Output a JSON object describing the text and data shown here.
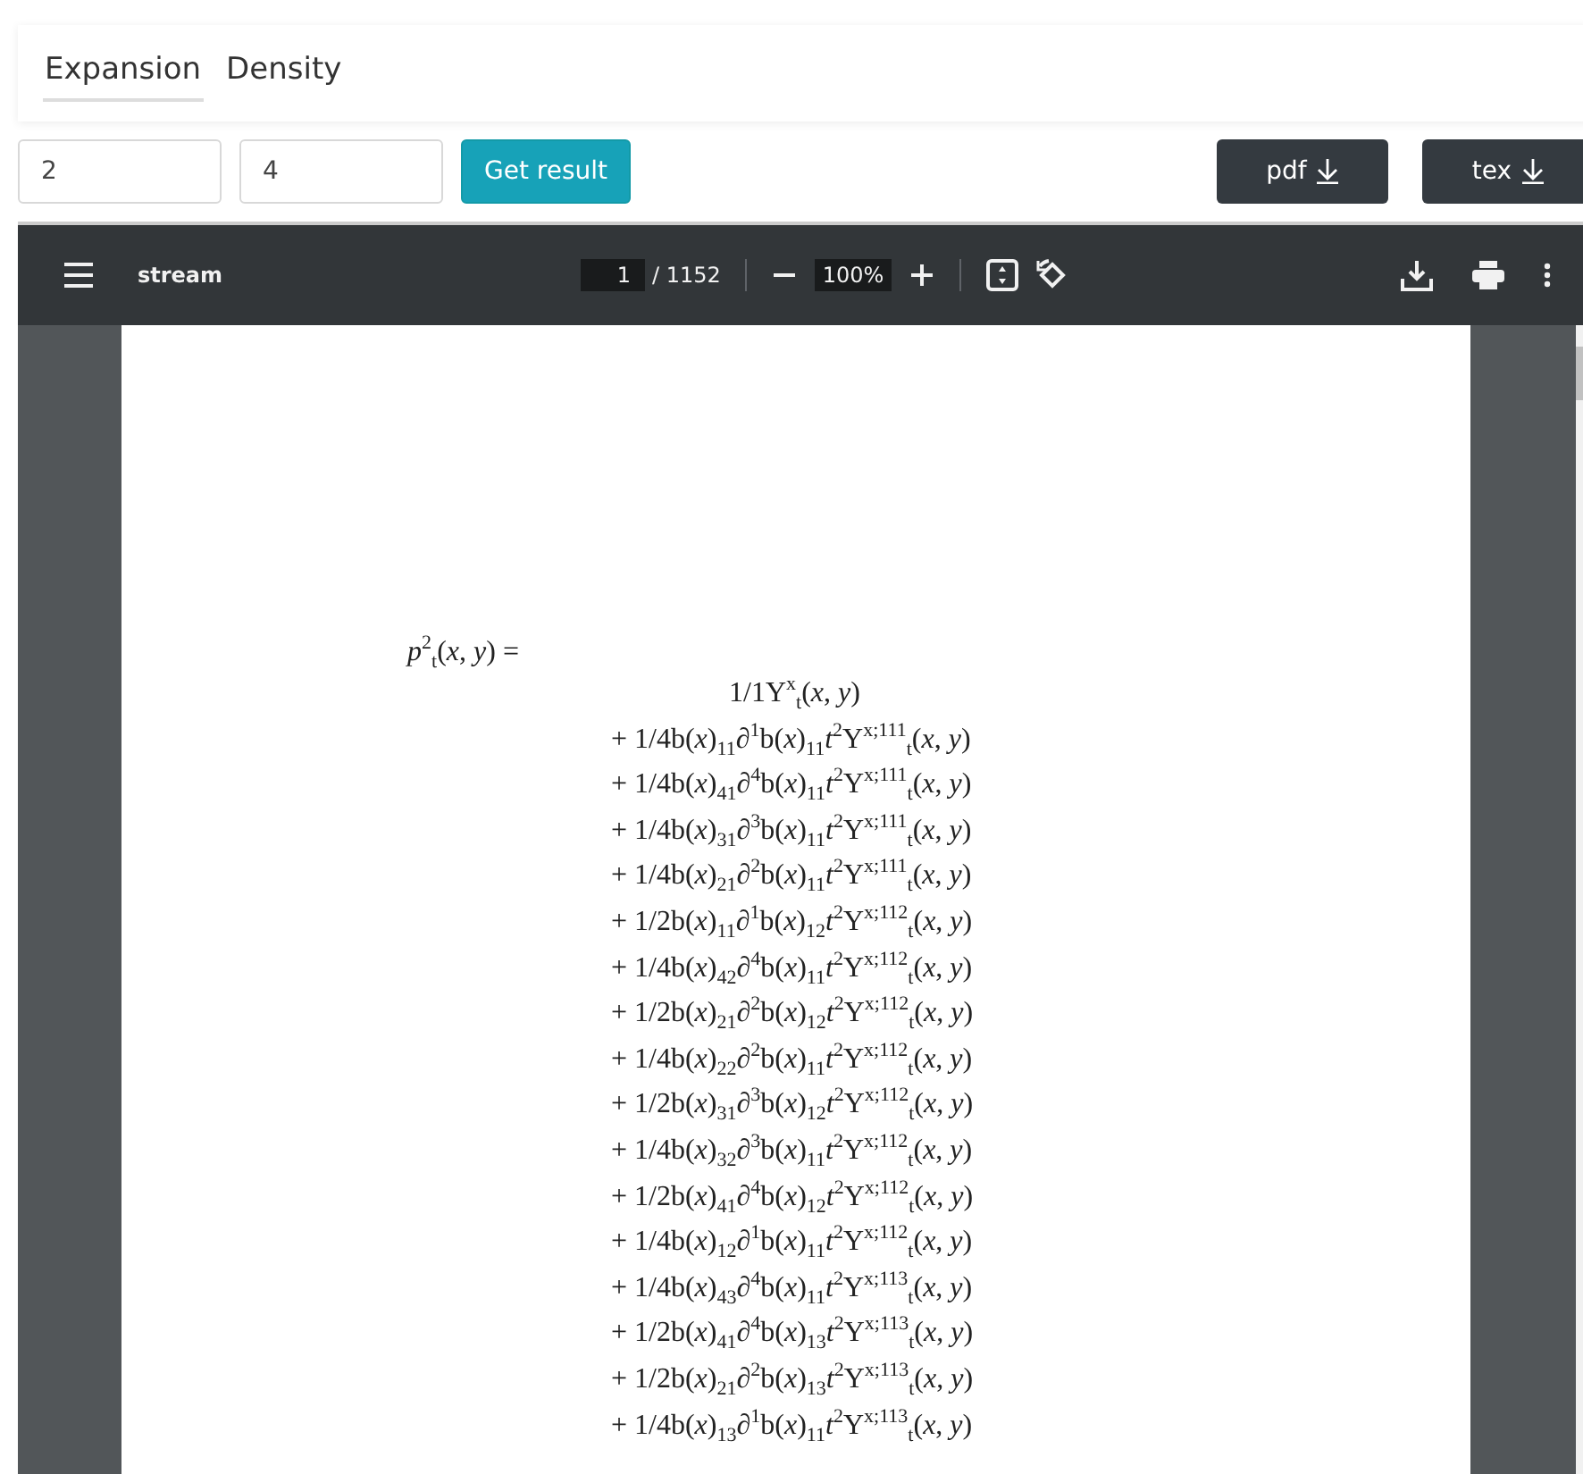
{
  "tabs": [
    {
      "label": "Expansion",
      "selected": true
    },
    {
      "label": "Density",
      "selected": false
    }
  ],
  "inputs": [
    {
      "value": "2"
    },
    {
      "value": "4"
    }
  ],
  "submit_button": "Get result",
  "download_buttons": [
    {
      "label": "pdf"
    },
    {
      "label": "tex"
    }
  ],
  "viewer": {
    "title": "stream",
    "page_input": "1",
    "page_count": "/ 1152",
    "zoom": "100%"
  },
  "document": {
    "lhs": "*p*$^{2}$$_{t}$(*x*, *y*) =",
    "terms": [
      "1/1Υ$^{x}$$_{t}$(*x*, *y*)",
      "+ 1/4b(*x*)$_{11}$∂$^{1}$b(*x*)$_{11}$*t*$^{2}$Υ$^{x;111}$$_{t}$(*x*, *y*)",
      "+ 1/4b(*x*)$_{41}$∂$^{4}$b(*x*)$_{11}$*t*$^{2}$Υ$^{x;111}$$_{t}$(*x*, *y*)",
      "+ 1/4b(*x*)$_{31}$∂$^{3}$b(*x*)$_{11}$*t*$^{2}$Υ$^{x;111}$$_{t}$(*x*, *y*)",
      "+ 1/4b(*x*)$_{21}$∂$^{2}$b(*x*)$_{11}$*t*$^{2}$Υ$^{x;111}$$_{t}$(*x*, *y*)",
      "+ 1/2b(*x*)$_{11}$∂$^{1}$b(*x*)$_{12}$*t*$^{2}$Υ$^{x;112}$$_{t}$(*x*, *y*)",
      "+ 1/4b(*x*)$_{42}$∂$^{4}$b(*x*)$_{11}$*t*$^{2}$Υ$^{x;112}$$_{t}$(*x*, *y*)",
      "+ 1/2b(*x*)$_{21}$∂$^{2}$b(*x*)$_{12}$*t*$^{2}$Υ$^{x;112}$$_{t}$(*x*, *y*)",
      "+ 1/4b(*x*)$_{22}$∂$^{2}$b(*x*)$_{11}$*t*$^{2}$Υ$^{x;112}$$_{t}$(*x*, *y*)",
      "+ 1/2b(*x*)$_{31}$∂$^{3}$b(*x*)$_{12}$*t*$^{2}$Υ$^{x;112}$$_{t}$(*x*, *y*)",
      "+ 1/4b(*x*)$_{32}$∂$^{3}$b(*x*)$_{11}$*t*$^{2}$Υ$^{x;112}$$_{t}$(*x*, *y*)",
      "+ 1/2b(*x*)$_{41}$∂$^{4}$b(*x*)$_{12}$*t*$^{2}$Υ$^{x;112}$$_{t}$(*x*, *y*)",
      "+ 1/4b(*x*)$_{12}$∂$^{1}$b(*x*)$_{11}$*t*$^{2}$Υ$^{x;112}$$_{t}$(*x*, *y*)",
      "+ 1/4b(*x*)$_{43}$∂$^{4}$b(*x*)$_{11}$*t*$^{2}$Υ$^{x;113}$$_{t}$(*x*, *y*)",
      "+ 1/2b(*x*)$_{41}$∂$^{4}$b(*x*)$_{13}$*t*$^{2}$Υ$^{x;113}$$_{t}$(*x*, *y*)",
      "+ 1/2b(*x*)$_{21}$∂$^{2}$b(*x*)$_{13}$*t*$^{2}$Υ$^{x;113}$$_{t}$(*x*, *y*)",
      "+ 1/4b(*x*)$_{13}$∂$^{1}$b(*x*)$_{11}$*t*$^{2}$Υ$^{x;113}$$_{t}$(*x*, *y*)"
    ]
  }
}
